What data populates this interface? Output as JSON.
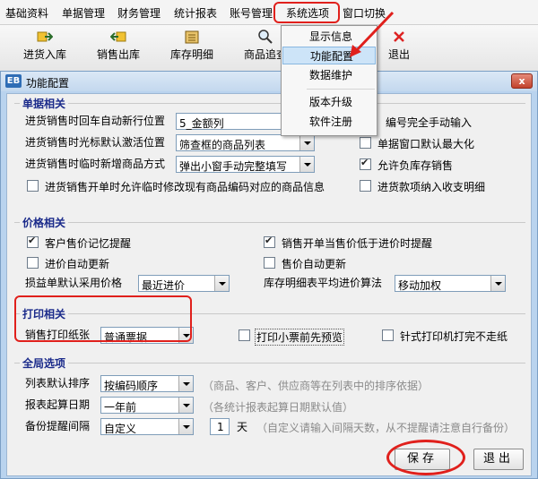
{
  "menubar": {
    "items": [
      "基础资料",
      "单据管理",
      "财务管理",
      "统计报表",
      "账号管理",
      "系统选项",
      "窗口切换"
    ]
  },
  "toolbar": {
    "buttons": [
      {
        "label": "进货入库",
        "icon": "import-icon"
      },
      {
        "label": "销售出库",
        "icon": "export-icon"
      },
      {
        "label": "库存明细",
        "icon": "inventory-icon"
      },
      {
        "label": "商品追查",
        "icon": "search-icon"
      },
      {
        "label": "退出",
        "icon": "exit-icon"
      }
    ]
  },
  "dropdown": {
    "items": [
      "显示信息",
      "功能配置",
      "数据维护",
      "版本升级",
      "软件注册"
    ],
    "selected": "功能配置"
  },
  "dialog": {
    "title": "功能配置",
    "icon_text": "EB",
    "close_label": "x",
    "groups": {
      "documents": {
        "title": "单据相关",
        "rows": {
          "auto_row_label": "进货销售时回车自动新行位置",
          "auto_row_value": "5_金额列",
          "cursor_label": "进货销售时光标默认激活位置",
          "cursor_value": "筛查框的商品列表",
          "new_goods_label": "进货销售时临时新增商品方式",
          "new_goods_value": "弹出小窗手动完整填写",
          "manual_code_label": "编号完全手动输入",
          "maximize_label": "单据窗口默认最大化",
          "negative_stock_label": "允许负库存销售",
          "modify_code_label": "进货销售开单时允许临时修改现有商品编码对应的商品信息",
          "ledger_label": "进货款项纳入收支明细"
        }
      },
      "price": {
        "title": "价格相关",
        "remember_price_label": "客户售价记忆提醒",
        "below_cost_label": "销售开单当售价低于进价时提醒",
        "auto_cost_label": "进价自动更新",
        "auto_price_label": "售价自动更新",
        "loss_price_label": "损益单默认采用价格",
        "loss_price_value": "最近进价",
        "avg_cost_label": "库存明细表平均进价算法",
        "avg_cost_value": "移动加权"
      },
      "print": {
        "title": "打印相关",
        "paper_label": "销售打印纸张",
        "paper_value": "普通票据",
        "preview_label": "打印小票前先预览",
        "no_feed_label": "针式打印机打完不走纸"
      },
      "global": {
        "title": "全局选项",
        "sort_label": "列表默认排序",
        "sort_value": "按编码顺序",
        "sort_note": "（商品、客户、供应商等在列表中的排序依据）",
        "start_label": "报表起算日期",
        "start_value": "一年前",
        "start_note": "（各统计报表起算日期默认值）",
        "backup_label": "备份提醒间隔",
        "backup_value": "自定义",
        "backup_days": "1",
        "backup_unit": "天",
        "backup_note": "（自定义请输入间隔天数，从不提醒请注意自行备份）"
      }
    },
    "buttons": {
      "save": "保存",
      "exit": "退出"
    }
  },
  "colors": {
    "annotation": "#e0201c",
    "dialog_frame": "#b9d3ee",
    "group_title": "#1a2a8a"
  },
  "checkboxes": {
    "manual_code": false,
    "maximize": false,
    "negative_stock": true,
    "modify_code": false,
    "ledger": false,
    "remember_price": true,
    "below_cost": true,
    "auto_cost": false,
    "auto_price": false,
    "preview": false,
    "no_feed": false
  }
}
